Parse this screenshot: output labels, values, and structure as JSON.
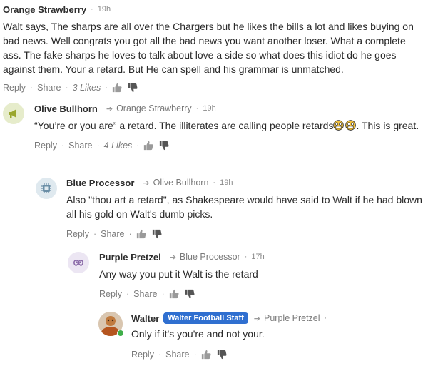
{
  "comments": [
    {
      "author": "Orange Strawberry",
      "time": "19h",
      "text": "Walt says, The sharps are all over the Chargers but he likes the bills a lot and likes buying on bad news. Well congrats you got all the bad news you want another loser. What a complete ass. The fake sharps he loves to talk about love a side so what does this idiot do he goes against them. Your a retard. But He can spell and his grammar is unmatched.",
      "reply_label": "Reply",
      "share_label": "Share",
      "likes": "3 Likes"
    },
    {
      "author": "Olive Bullhorn",
      "reply_to": "Orange Strawberry",
      "time": "19h",
      "text_before": "“You’re or you are” a retard.  The illiterates are calling people retards",
      "text_after": ".  This is great.",
      "reply_label": "Reply",
      "share_label": "Share",
      "likes": "4 Likes"
    },
    {
      "author": "Blue Processor",
      "reply_to": "Olive Bullhorn",
      "time": "19h",
      "text": "Also \"thou art a retard\", as Shakespeare would have said to Walt if he had blown all his gold on Walt's dumb picks.",
      "reply_label": "Reply",
      "share_label": "Share"
    },
    {
      "author": "Purple Pretzel",
      "reply_to": "Blue Processor",
      "time": "17h",
      "text": "Any way you put it Walt is the retard",
      "reply_label": "Reply",
      "share_label": "Share"
    },
    {
      "author": "Walter",
      "badge": "Walter Football Staff",
      "reply_to": "Purple Pretzel",
      "text": "Only if it's you're and not your.",
      "reply_label": "Reply",
      "share_label": "Share"
    }
  ],
  "colors": {
    "badge": "#2f6fd0",
    "olive_avatar": "#e6eccb",
    "blue_avatar": "#dfe9ef",
    "purple_avatar": "#ece6f3",
    "online": "#3fae49"
  }
}
